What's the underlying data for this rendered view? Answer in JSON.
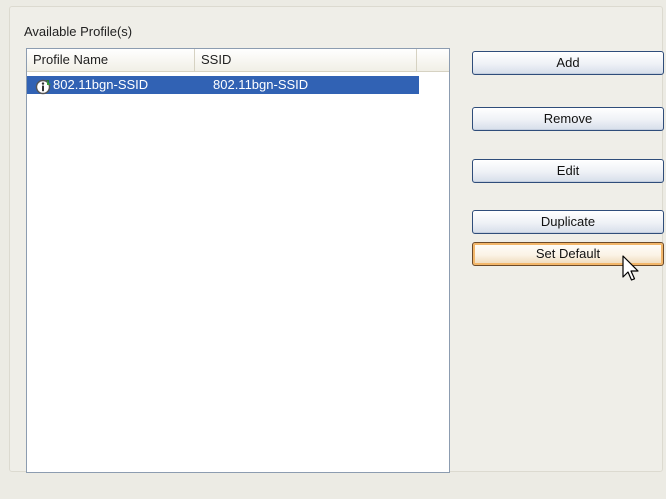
{
  "group": {
    "label": "Available Profile(s)"
  },
  "list": {
    "columns": [
      "Profile Name",
      "SSID"
    ],
    "rows": [
      {
        "icon": "profile-info-icon",
        "profile_name": "802.11bgn-SSID",
        "ssid": "802.11bgn-SSID",
        "selected": true
      }
    ]
  },
  "buttons": {
    "add": "Add",
    "remove": "Remove",
    "edit": "Edit",
    "duplicate": "Duplicate",
    "set_default": "Set Default"
  },
  "colors": {
    "selection": "#3162b4",
    "button_border": "#2f4d7a",
    "focus_ring": "#f2b66a"
  }
}
